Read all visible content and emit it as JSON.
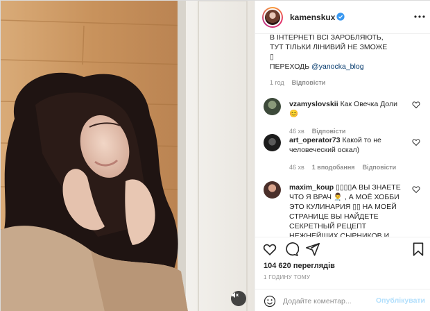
{
  "post": {
    "username": "kamenskux",
    "verified": true,
    "caption_lines": [
      "В ІНТЕРНЕТІ ВСІ ЗАРОБЛЯЮТЬ,",
      "ТУТ ТІЛЬКИ ЛІНИВИЙ НЕ ЗМОЖЕ",
      "▯"
    ],
    "caption_link_prefix": "ПЕРЕХОДЬ ",
    "caption_link": "@yanocka_blog",
    "caption_time": "1 год",
    "caption_reply": "Відповісти",
    "views": "104 620 переглядів",
    "posted": "1 ГОДИНУ ТОМУ"
  },
  "comments": [
    {
      "user": "vzamyslovskii",
      "text": "Как Овечка Доли😊",
      "time": "46 хв",
      "reply": "Відповісти",
      "avatar_color": "#3d4a3a"
    },
    {
      "user": "art_operator73",
      "text": "Какой то не человеческий оскал)",
      "time": "46 хв",
      "replies": "1 вподобання",
      "reply": "Відповісти",
      "avatar_color": "#1c1c1c"
    },
    {
      "user": "maxim_koup",
      "text": "▯▯▯▯А ВЫ ЗНАЕТЕ ЧТО Я ВРАЧ 👨‍⚕️ , А МОЁ ХОББИ ЭТО КУЛИНАРИЯ ▯▯ НА МОЕЙ СТРАНИЦЕ ВЫ НАЙДЕТЕ СЕКРЕТНЫЙ РЕЦЕПТ НЕЖНЕЙШИХ СЫРНИКОВ И",
      "avatar_color": "#4a2f2a"
    }
  ],
  "add_comment": {
    "placeholder": "Додайте коментар...",
    "publish": "Опублікувати"
  },
  "icons": {
    "more": "more-dots-icon",
    "like": "heart-icon",
    "comment": "comment-icon",
    "share": "share-icon",
    "save": "bookmark-icon",
    "emoji": "emoji-icon",
    "mute": "muted-speaker-icon"
  },
  "colors": {
    "verified": "#3897f0",
    "link": "#00376b",
    "muted_text": "#8e8e8e",
    "publish_disabled": "#b2dffc"
  }
}
